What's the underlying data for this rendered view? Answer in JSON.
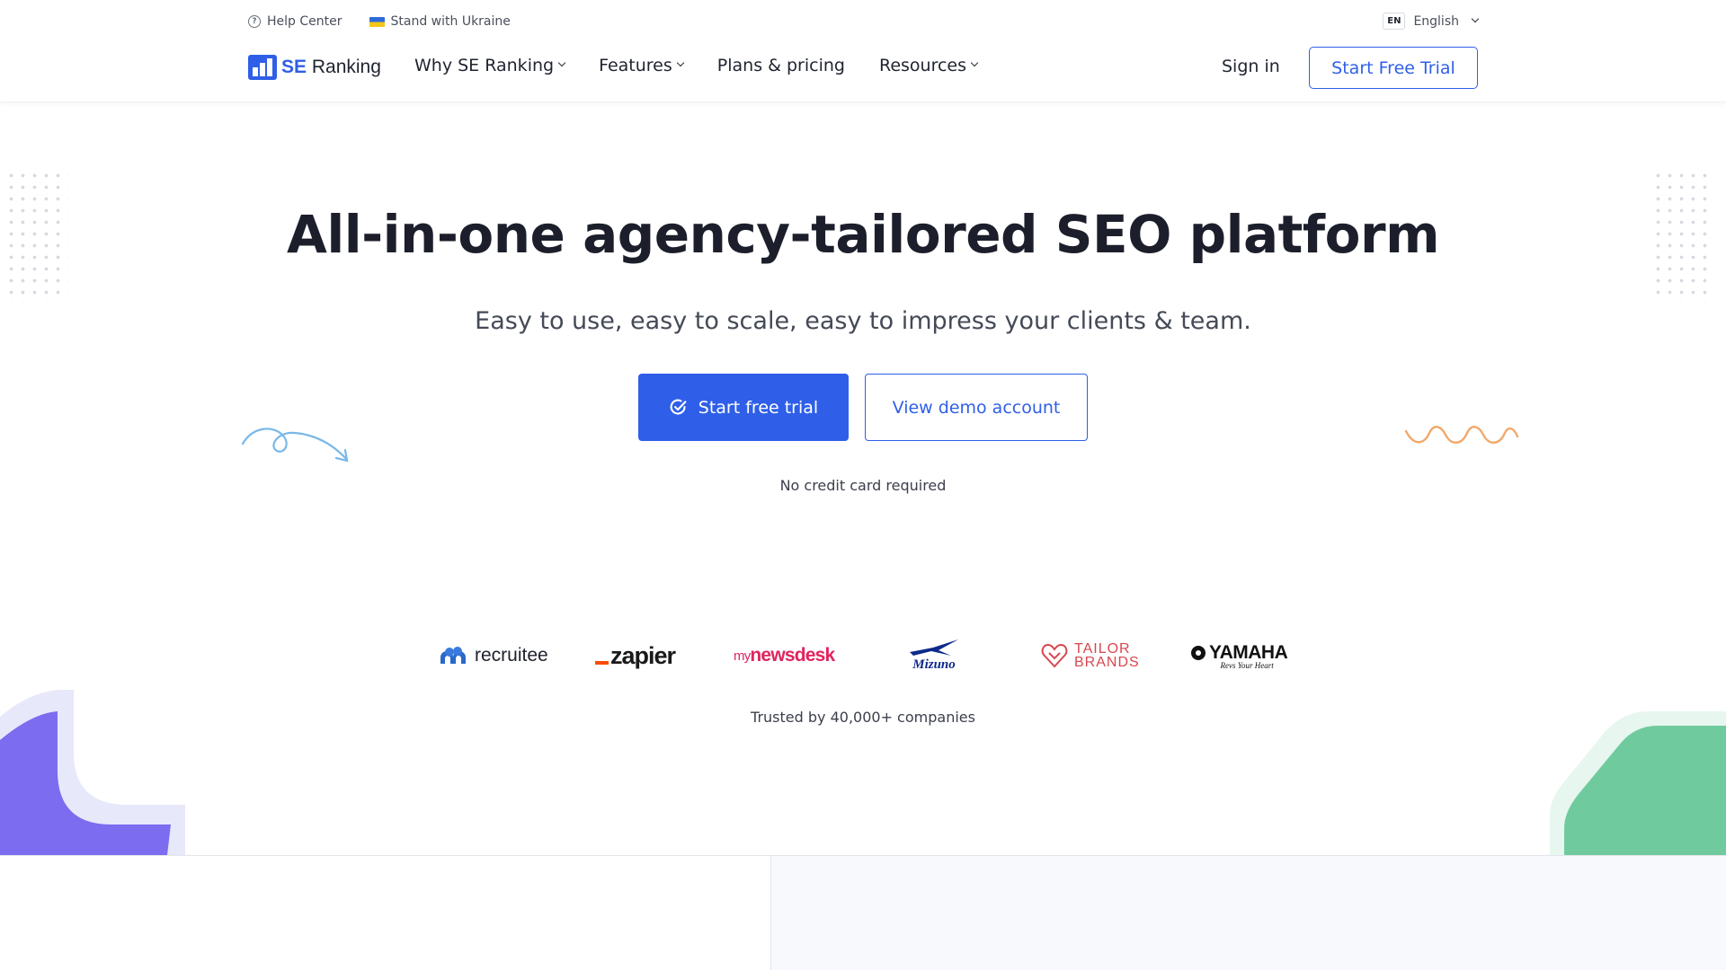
{
  "utility": {
    "help_center": "Help Center",
    "ukraine": "Stand with Ukraine",
    "lang_code": "EN",
    "lang_name": "English"
  },
  "header": {
    "logo_se": "SE",
    "logo_ranking": "Ranking",
    "nav": {
      "why": "Why SE Ranking",
      "features": "Features",
      "plans": "Plans & pricing",
      "resources": "Resources"
    },
    "sign_in": "Sign in",
    "start_trial": "Start Free Trial"
  },
  "hero": {
    "title": "All-in-one agency-tailored SEO platform",
    "subtitle": "Easy to use, easy to scale, easy to impress your clients & team.",
    "cta_primary": "Start free trial",
    "cta_secondary": "View demo account",
    "note": "No credit card required"
  },
  "logos": {
    "recruitee": "recruitee",
    "zapier": "zapier",
    "newsdesk_my": "my",
    "newsdesk_main": "newsdesk",
    "mizuno": "Mizuno",
    "tailor_line1": "TAILOR",
    "tailor_line2": "BRANDS",
    "yamaha": "YAMAHA",
    "yamaha_tag": "Revs Your Heart",
    "trusted": "Trusted by 40,000+ companies"
  },
  "colors": {
    "primary": "#2f5fe8",
    "text": "#1c1f2b",
    "deco_purple": "#7b6cf0",
    "deco_green": "#6fcb9e",
    "squiggle_blue": "#7ab8e8",
    "squiggle_orange": "#f0a86a"
  }
}
